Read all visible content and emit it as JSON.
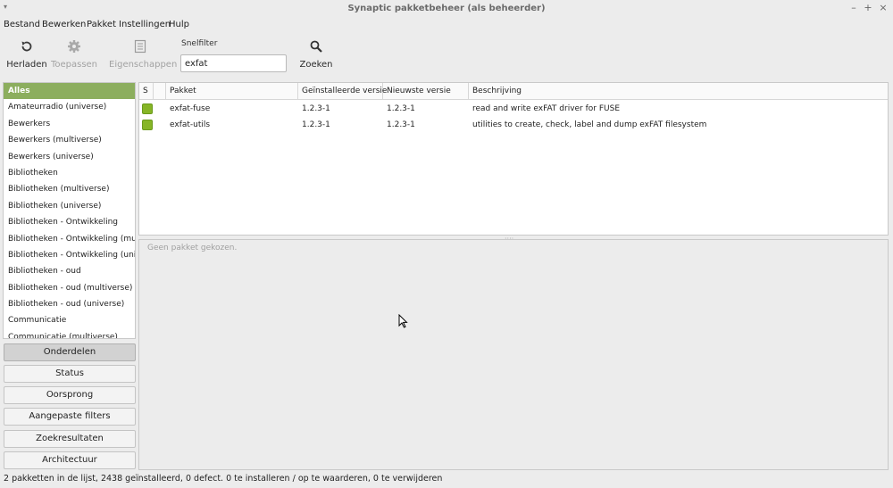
{
  "window": {
    "title": "Synaptic pakketbeheer  (als beheerder)",
    "menu_glyph": "▾",
    "minimize": "–",
    "maximize": "+",
    "close": "×"
  },
  "menubar": [
    "Bestand",
    "Bewerken",
    "Pakket",
    "Instellingen",
    "Hulp"
  ],
  "toolbar": {
    "reload_label": "Herladen",
    "apply_label": "Toepassen",
    "properties_label": "Eigenschappen",
    "quickfilter_label": "Snelfilter",
    "quickfilter_value": "exfat",
    "search_label": "Zoeken"
  },
  "categories": [
    "Alles",
    "Amateurradio (universe)",
    "Bewerkers",
    "Bewerkers (multiverse)",
    "Bewerkers (universe)",
    "Bibliotheken",
    "Bibliotheken (multiverse)",
    "Bibliotheken (universe)",
    "Bibliotheken - Ontwikkeling",
    "Bibliotheken - Ontwikkeling (multive",
    "Bibliotheken - Ontwikkeling (univer",
    "Bibliotheken - oud",
    "Bibliotheken - oud (multiverse)",
    "Bibliotheken - oud (universe)",
    "Communicatie",
    "Communicatie (multiverse)"
  ],
  "selected_category_index": 0,
  "side_buttons": [
    "Onderdelen",
    "Status",
    "Oorsprong",
    "Aangepaste filters",
    "Zoekresultaten",
    "Architectuur"
  ],
  "active_side_button_index": 0,
  "table": {
    "headers": [
      "S",
      "Pakket",
      "Geïnstalleerde versie",
      "Nieuwste versie",
      "Beschrijving"
    ],
    "rows": [
      {
        "package": "exfat-fuse",
        "installed": "1.2.3-1",
        "latest": "1.2.3-1",
        "description": "read and write exFAT driver for FUSE",
        "status": "installed"
      },
      {
        "package": "exfat-utils",
        "installed": "1.2.3-1",
        "latest": "1.2.3-1",
        "description": "utilities to create, check, label and dump exFAT filesystem",
        "status": "installed"
      }
    ]
  },
  "detail": {
    "empty_text": "Geen pakket gekozen."
  },
  "statusbar": "2 pakketten in de lijst, 2438 geïnstalleerd, 0 defect. 0 te installeren / op te waarderen, 0 te verwijderen",
  "colors": {
    "selected_category": "#8cae5e",
    "installed_status": "#86b526"
  }
}
